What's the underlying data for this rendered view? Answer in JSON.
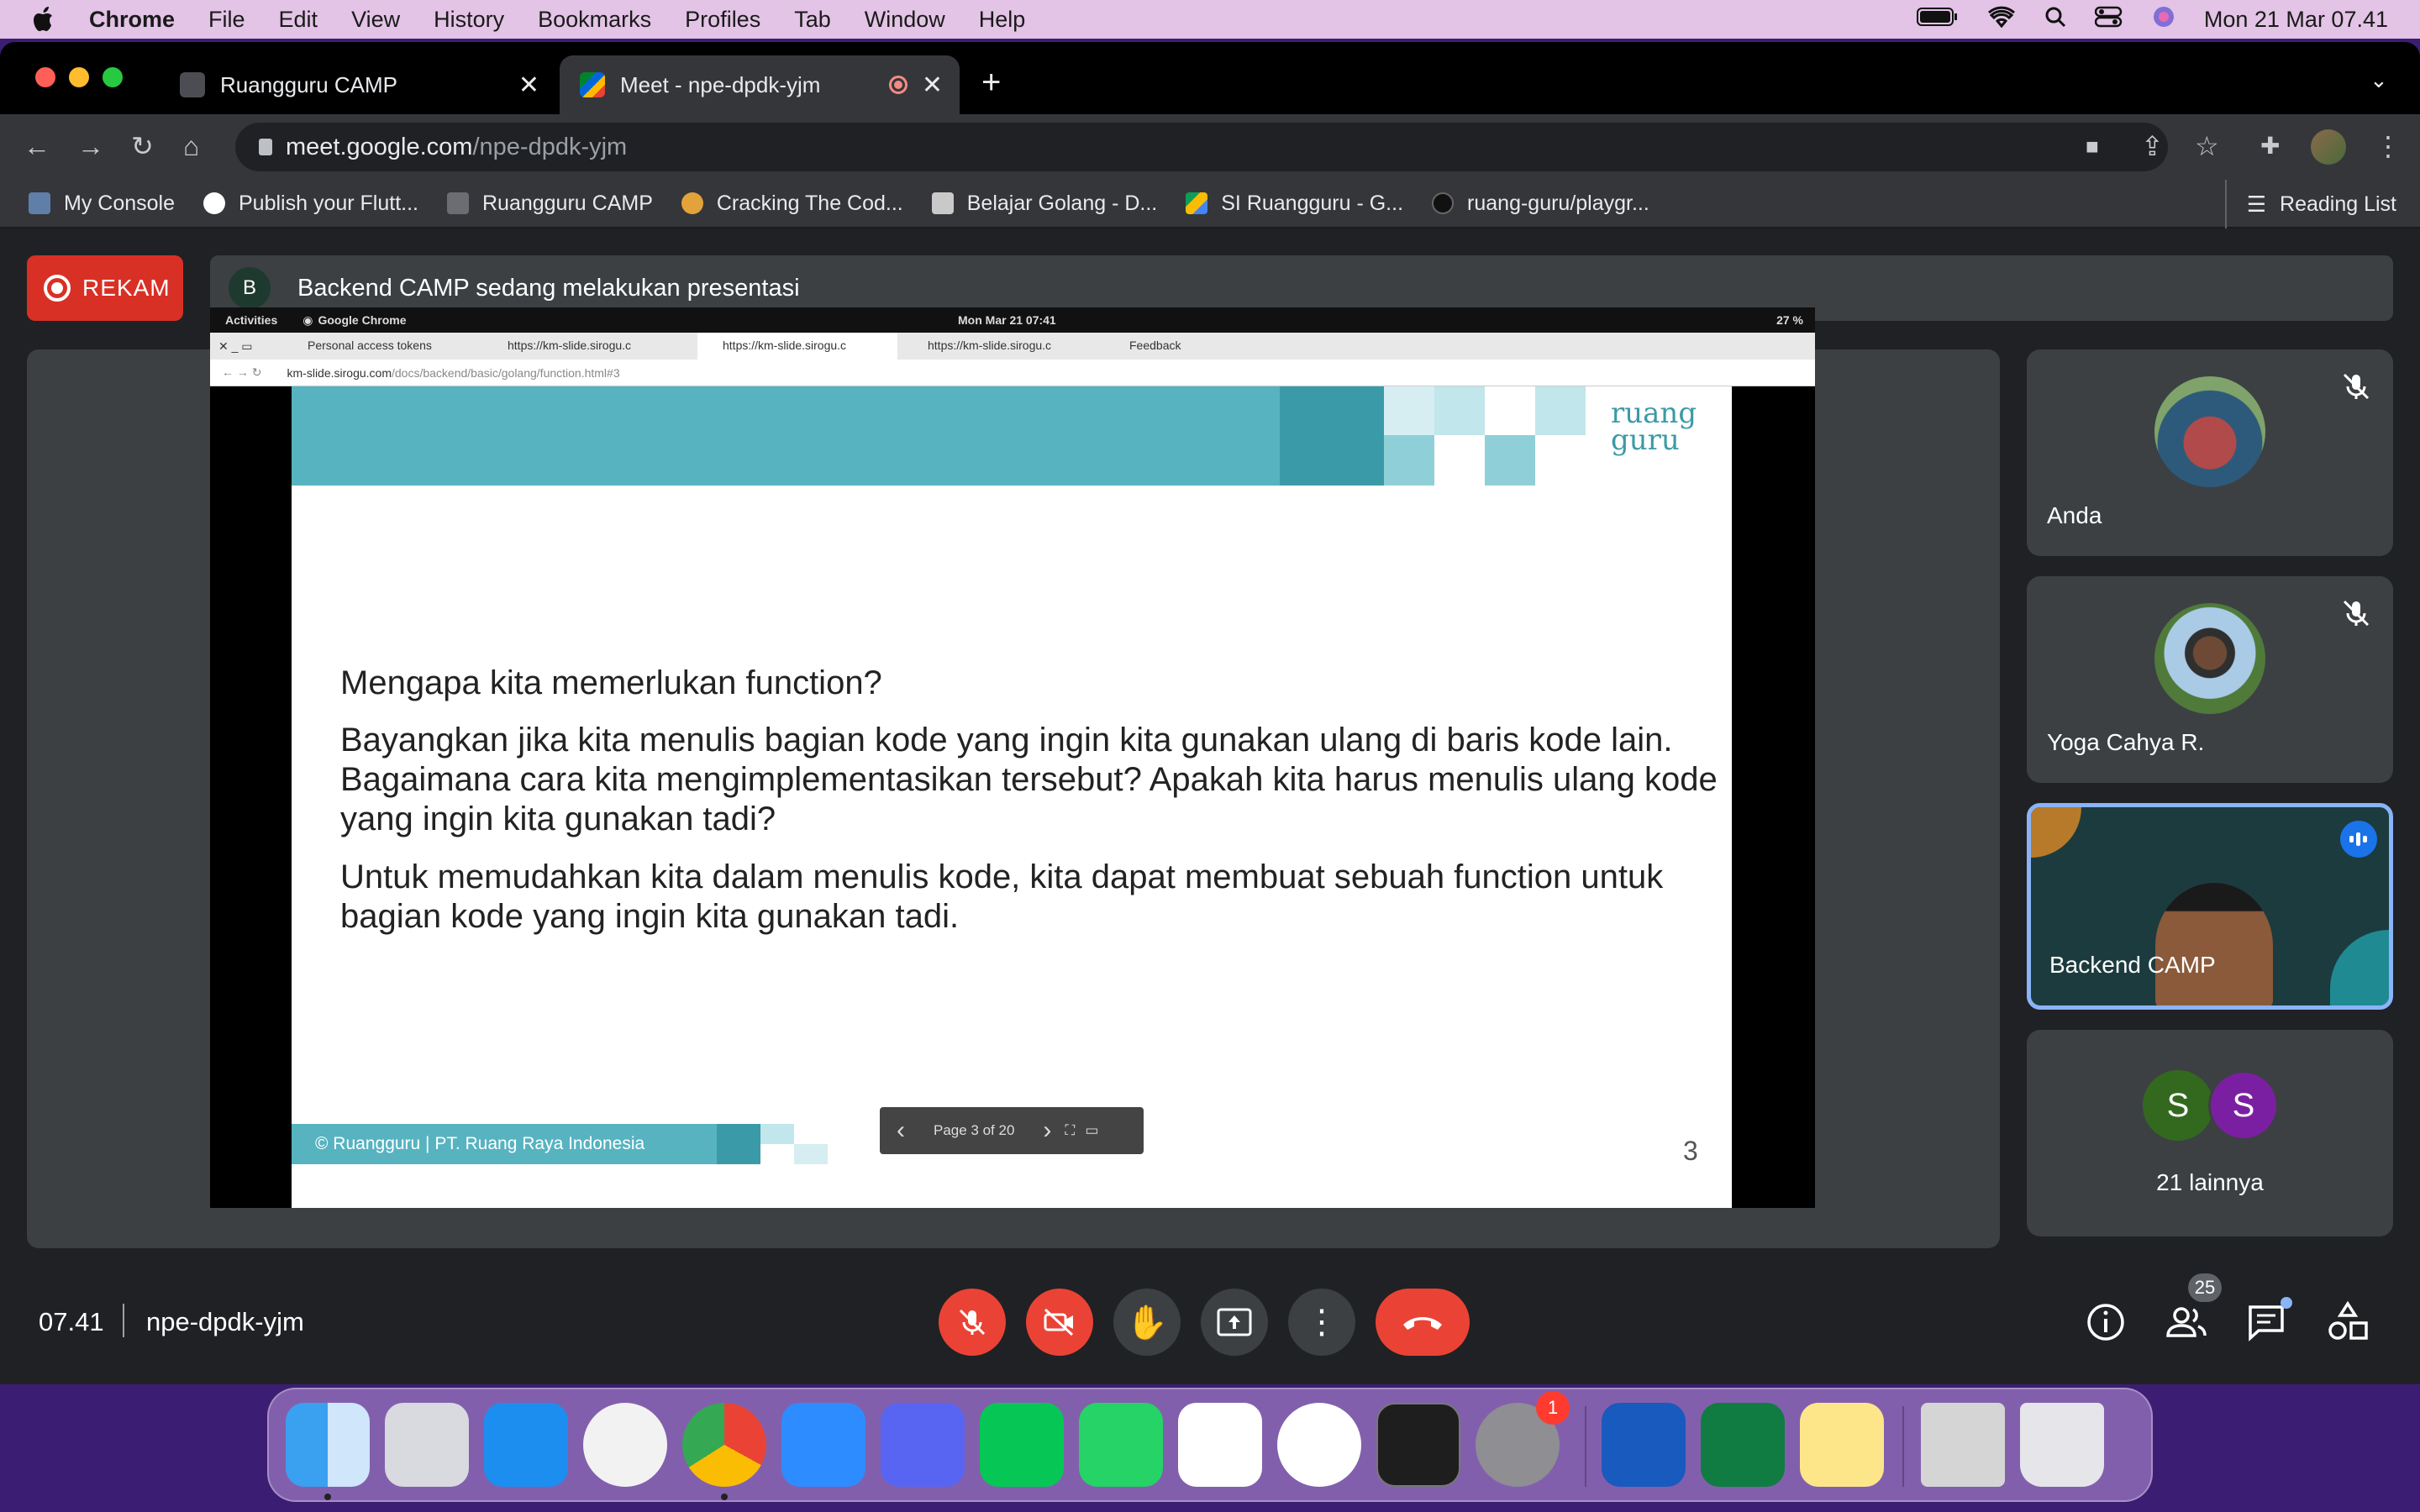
{
  "menubar": {
    "app": "Chrome",
    "items": [
      "File",
      "Edit",
      "View",
      "History",
      "Bookmarks",
      "Profiles",
      "Tab",
      "Window",
      "Help"
    ],
    "clock": "Mon 21 Mar  07.41"
  },
  "tabs": [
    {
      "title": "Ruangguru CAMP",
      "active": false
    },
    {
      "title": "Meet - npe-dpdk-yjm",
      "active": true
    }
  ],
  "omnibox": {
    "host": "meet.google.com",
    "path": "/npe-dpdk-yjm"
  },
  "bookmarks": [
    "My Console",
    "Publish your Flutt...",
    "Ruangguru CAMP",
    "Cracking The Cod...",
    "Belajar Golang - D...",
    "SI Ruangguru - G...",
    "ruang-guru/playgr..."
  ],
  "reading_list": "Reading List",
  "meet": {
    "record_label": "REKAM",
    "banner_initial": "B",
    "banner_text": "Backend CAMP sedang melakukan presentasi",
    "time": "07.41",
    "code": "npe-dpdk-yjm",
    "people_count": "25",
    "participants": [
      {
        "name": "Anda",
        "muted": true
      },
      {
        "name": "Yoga Cahya R.",
        "muted": true
      },
      {
        "name": "Backend CAMP",
        "speaking": true
      }
    ],
    "others": {
      "initials": [
        "S",
        "S"
      ],
      "label": "21 lainnya"
    }
  },
  "shared": {
    "gnome_activities": "Activities",
    "gnome_app": "Google Chrome",
    "gnome_clock": "Mon Mar 21  07:41",
    "gnome_battery": "27 %",
    "inner_tabs": [
      "Personal access tokens",
      "https://km-slide.sirogu.c",
      "https://km-slide.sirogu.c",
      "https://km-slide.sirogu.c",
      "Feedback"
    ],
    "inner_url_host": "km-slide.sirogu.com",
    "inner_url_path": "/docs/backend/basic/golang/function.html#3",
    "slide": {
      "logo_line1": "ruang",
      "logo_line2": "guru",
      "heading": "Mengapa kita memerlukan function?",
      "para1": "Bayangkan jika kita menulis bagian kode yang ingin kita gunakan ulang di baris kode lain. Bagaimana cara kita mengimplementasikan tersebut? Apakah kita harus menulis ulang kode yang ingin kita gunakan tadi?",
      "para2": "Untuk memudahkan kita dalam menulis kode, kita dapat membuat sebuah function untuk bagian kode yang ingin kita gunakan tadi.",
      "footer": "© Ruangguru | PT. Ruang Raya Indonesia",
      "pager": "Page 3 of 20",
      "page_number": "3"
    }
  },
  "dock": {
    "notification_badge": "1"
  }
}
